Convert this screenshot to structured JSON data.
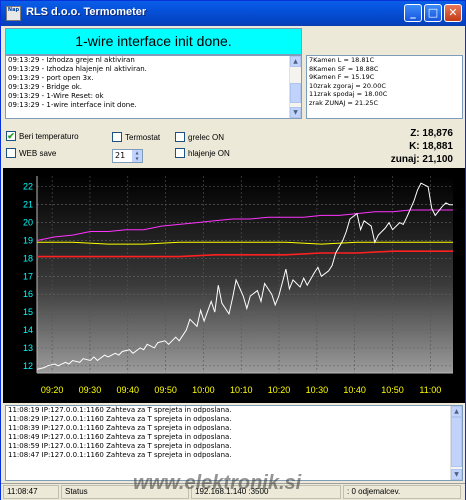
{
  "window": {
    "title": "RLS d.o.o. Termometer",
    "icon_text": "Nap",
    "icon": "app-icon",
    "minimize_glyph": "_",
    "maximize_glyph": "□",
    "close_glyph": "✕"
  },
  "banner": {
    "text": "1-wire interface init done.",
    "color": "#00ffff"
  },
  "top_log": [
    "09:13:29 - Izhodza greje nl aktiviran",
    "09:13:29 - Izhodza hlajenje nl aktiviran.",
    "09:13:29 - port open 3x.",
    "09:13:29 - Bridge ok.",
    "09:13:29 - 1-Wire Reset: ok",
    "09:13:29 - 1-wire interface init done."
  ],
  "sensors": [
    "7Kamen L = 18.81C",
    "8Kamen SF = 18.88C",
    "9Kamen F = 15.19C",
    "10zrak zgoraj = 20.00C",
    "11zrak spodaj = 18.00C",
    "zrak ZUNAJ = 21.25C"
  ],
  "controls": {
    "beri_temperaturo": "Beri temperaturo",
    "beri_checked": true,
    "web_save": "WEB save",
    "web_checked": false,
    "termostat": "Termostat",
    "termostat_checked": false,
    "interval_value": "21",
    "greles": "grelec ON",
    "greles_checked": false,
    "hladenje": "hlajenje ON",
    "hladenje_checked": false,
    "check_glyph": "✔"
  },
  "readouts": {
    "z": "Z: 18,876",
    "k": "K: 18,881",
    "zunaj": "zunaj: 21,100"
  },
  "chart_data": {
    "type": "line",
    "y_ticks": [
      12,
      13,
      14,
      15,
      16,
      17,
      18,
      19,
      20,
      21,
      22
    ],
    "x_ticks": [
      "09:20",
      "09:30",
      "09:40",
      "09:50",
      "10:00",
      "10:10",
      "10:20",
      "10:30",
      "10:40",
      "10:50",
      "11:00"
    ],
    "ylim": [
      11.6,
      22.6
    ],
    "xlim": [
      0,
      117
    ],
    "grid": true,
    "background_top": "#000000",
    "background_bottom": "#9c9c9c",
    "series": [
      {
        "color": "#ffffff",
        "x": [
          0,
          2,
          3,
          5,
          6,
          8,
          9,
          10,
          12,
          13,
          15,
          16,
          17,
          19,
          20,
          22,
          23,
          24,
          26,
          27,
          29,
          30,
          31,
          33,
          34,
          36,
          37,
          39,
          40,
          42,
          43,
          45,
          46,
          47,
          49,
          50,
          51,
          52,
          54,
          55,
          56,
          58,
          59,
          60,
          62,
          63,
          64,
          66,
          67,
          68,
          70,
          71,
          72,
          74,
          75,
          76,
          78,
          79,
          80,
          82,
          83,
          84,
          86,
          87,
          88,
          90,
          91,
          92,
          94,
          95,
          96,
          98,
          99,
          100,
          102,
          103,
          104,
          106,
          107,
          108,
          110,
          111,
          112,
          114,
          115,
          116,
          117
        ],
        "y": [
          11.8,
          11.9,
          12.0,
          12.1,
          12.0,
          12.2,
          12.1,
          12.3,
          12.2,
          12.4,
          12.3,
          12.5,
          12.3,
          12.6,
          12.5,
          12.7,
          12.6,
          12.8,
          12.9,
          12.7,
          13.0,
          12.9,
          13.2,
          13.0,
          13.3,
          13.4,
          13.2,
          13.6,
          13.4,
          14.0,
          14.6,
          14.2,
          15.1,
          14.5,
          15.6,
          15.0,
          16.5,
          15.5,
          14.9,
          15.8,
          16.8,
          15.9,
          15.2,
          15.9,
          16.2,
          15.6,
          16.6,
          16.0,
          15.4,
          15.9,
          17.4,
          16.3,
          16.8,
          16.4,
          16.9,
          16.5,
          17.2,
          17.5,
          17.0,
          17.3,
          17.6,
          18.3,
          19.0,
          19.5,
          20.2,
          20.5,
          19.6,
          20.1,
          19.8,
          18.9,
          19.3,
          19.7,
          20.0,
          19.6,
          20.0,
          19.9,
          20.3,
          21.2,
          21.8,
          22.2,
          22.0,
          20.8,
          20.4,
          20.9,
          21.1,
          21.0,
          21.0
        ]
      },
      {
        "color": "#ff33ff",
        "x": [
          0,
          5,
          10,
          15,
          20,
          25,
          30,
          35,
          40,
          45,
          50,
          55,
          60,
          65,
          70,
          75,
          80,
          85,
          90,
          95,
          100,
          105,
          110,
          117
        ],
        "y": [
          19.0,
          19.2,
          19.3,
          19.5,
          19.5,
          19.6,
          19.6,
          19.8,
          19.9,
          20.0,
          20.1,
          20.2,
          20.2,
          20.3,
          20.3,
          20.3,
          20.4,
          20.4,
          20.5,
          20.6,
          20.6,
          20.7,
          20.7,
          20.7
        ]
      },
      {
        "color": "#ffff00",
        "x": [
          0,
          10,
          20,
          30,
          40,
          50,
          60,
          70,
          80,
          90,
          100,
          110,
          117
        ],
        "y": [
          18.9,
          18.9,
          18.8,
          18.8,
          18.9,
          18.9,
          18.9,
          18.9,
          18.8,
          18.9,
          18.9,
          18.9,
          18.9
        ]
      },
      {
        "color": "#ff2020",
        "x": [
          0,
          10,
          20,
          30,
          40,
          50,
          60,
          70,
          80,
          90,
          100,
          110,
          117
        ],
        "y": [
          18.1,
          18.1,
          18.1,
          18.1,
          18.1,
          18.2,
          18.2,
          18.2,
          18.3,
          18.3,
          18.4,
          18.4,
          18.4
        ]
      }
    ]
  },
  "bottom_log": [
    "11:08:19 IP:127.0.0.1:1160 Zahteva za T sprejeta in odposlana.",
    "11:08:29 IP:127.0.0.1:1160 Zahteva za T sprejeta in odposlana.",
    "11:08:39 IP:127.0.0.1:1160 Zahteva za T sprejeta in odposlana.",
    "11:08:49 IP:127.0.0.1:1160 Zahteva za T sprejeta in odposlana.",
    "11:08:59 IP:127.0.0.1:1160 Zahteva za T sprejeta in odposlana.",
    "11:08:47 IP:127.0.0.1:1160 Zahteva za T sprejeta in odposlana."
  ],
  "statusbar": {
    "time": "11:08:47",
    "status": "Status",
    "ip": "192.168.1.140 :3500",
    "clients": ": 0 odjemalcev."
  },
  "watermark": "www.elektronik.si"
}
